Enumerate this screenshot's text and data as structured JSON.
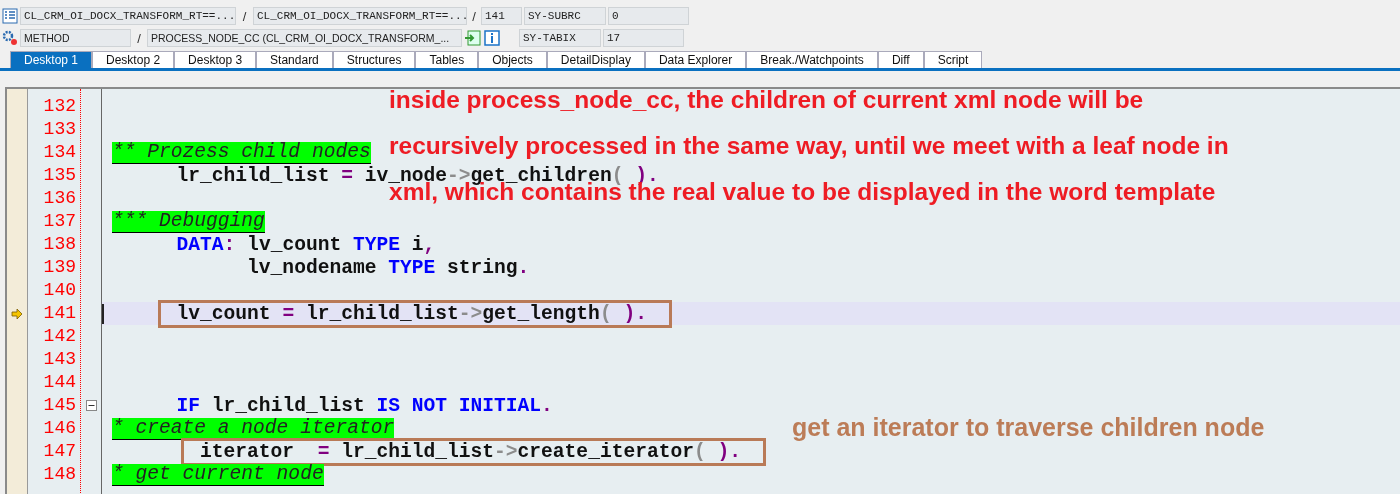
{
  "header": {
    "context": {
      "program": "CL_CRM_OI_DOCX_TRANSFORM_RT==...",
      "separator_1": "/",
      "include": "CL_CRM_OI_DOCX_TRANSFORM_RT==...",
      "separator_2": "/",
      "line": "141"
    },
    "event": {
      "type": "METHOD",
      "separator": "/",
      "name": "PROCESS_NODE_CC (CL_CRM_OI_DOCX_TRANSFORM_..."
    },
    "system_fields": [
      {
        "name": "SY-SUBRC",
        "value": "0"
      },
      {
        "name": "SY-TABIX",
        "value": "17"
      }
    ]
  },
  "tabs": [
    {
      "label": "Desktop 1",
      "selected": true
    },
    {
      "label": "Desktop 2",
      "selected": false
    },
    {
      "label": "Desktop 3",
      "selected": false
    },
    {
      "label": "Standard",
      "selected": false
    },
    {
      "label": "Structures",
      "selected": false
    },
    {
      "label": "Tables",
      "selected": false
    },
    {
      "label": "Objects",
      "selected": false
    },
    {
      "label": "DetailDisplay",
      "selected": false
    },
    {
      "label": "Data Explorer",
      "selected": false
    },
    {
      "label": "Break./Watchpoints",
      "selected": false
    },
    {
      "label": "Diff",
      "selected": false
    },
    {
      "label": "Script",
      "selected": false
    }
  ],
  "editor": {
    "lines": [
      {
        "number": "132",
        "kind": "blank",
        "current": false,
        "boxed": false,
        "fold": false
      },
      {
        "number": "133",
        "kind": "blank",
        "current": false,
        "boxed": false,
        "fold": false
      },
      {
        "number": "134",
        "kind": "comment",
        "text": "** Prozess child nodes",
        "current": false,
        "boxed": false,
        "fold": false
      },
      {
        "number": "135",
        "kind": "code",
        "tokens": [
          {
            "kind": "plain",
            "text": "lr_child_list "
          },
          {
            "kind": "op",
            "text": "="
          },
          {
            "kind": "plain",
            "text": " iv_node"
          },
          {
            "kind": "punct",
            "text": "->"
          },
          {
            "kind": "plain",
            "text": "get_children"
          },
          {
            "kind": "punct",
            "text": "( "
          },
          {
            "kind": "op",
            "text": ")."
          }
        ],
        "current": false,
        "boxed": false,
        "fold": false
      },
      {
        "number": "136",
        "kind": "blank",
        "current": false,
        "boxed": false,
        "fold": false
      },
      {
        "number": "137",
        "kind": "comment",
        "text": "*** Debugging",
        "current": false,
        "boxed": false,
        "fold": false
      },
      {
        "number": "138",
        "kind": "code",
        "tokens": [
          {
            "kind": "keyword",
            "text": "DATA"
          },
          {
            "kind": "op",
            "text": ":"
          },
          {
            "kind": "plain",
            "text": " lv_count "
          },
          {
            "kind": "keyword",
            "text": "TYPE"
          },
          {
            "kind": "plain",
            "text": " i"
          },
          {
            "kind": "op",
            "text": ","
          }
        ],
        "current": false,
        "boxed": false,
        "fold": false
      },
      {
        "number": "139",
        "kind": "code",
        "tokens": [
          {
            "kind": "plain",
            "text": "lv_nodename "
          },
          {
            "kind": "keyword",
            "text": "TYPE"
          },
          {
            "kind": "plain",
            "text": " string"
          },
          {
            "kind": "op",
            "text": "."
          }
        ],
        "current": false,
        "boxed": false,
        "fold": false
      },
      {
        "number": "140",
        "kind": "blank",
        "current": false,
        "boxed": false,
        "fold": false
      },
      {
        "number": "141",
        "kind": "code",
        "tokens": [
          {
            "kind": "plain",
            "text": "lv_count "
          },
          {
            "kind": "op",
            "text": "="
          },
          {
            "kind": "plain",
            "text": " lr_child_list"
          },
          {
            "kind": "punct",
            "text": "->"
          },
          {
            "kind": "plain",
            "text": "get_length"
          },
          {
            "kind": "punct",
            "text": "( "
          },
          {
            "kind": "op",
            "text": ")."
          }
        ],
        "current": true,
        "boxed": true,
        "fold": false
      },
      {
        "number": "142",
        "kind": "blank",
        "current": false,
        "boxed": false,
        "fold": false
      },
      {
        "number": "143",
        "kind": "blank",
        "current": false,
        "boxed": false,
        "fold": false
      },
      {
        "number": "144",
        "kind": "blank",
        "current": false,
        "boxed": false,
        "fold": false
      },
      {
        "number": "145",
        "kind": "code",
        "tokens": [
          {
            "kind": "keyword",
            "text": "IF"
          },
          {
            "kind": "plain",
            "text": " lr_child_list "
          },
          {
            "kind": "keyword",
            "text": "IS NOT INITIAL"
          },
          {
            "kind": "op",
            "text": "."
          }
        ],
        "current": false,
        "boxed": false,
        "fold": true
      },
      {
        "number": "146",
        "kind": "comment",
        "text": "* create a node iterator",
        "current": false,
        "boxed": false,
        "fold": false
      },
      {
        "number": "147",
        "kind": "code",
        "tokens": [
          {
            "kind": "plain",
            "text": "iterator  "
          },
          {
            "kind": "op",
            "text": "="
          },
          {
            "kind": "plain",
            "text": " lr_child_list"
          },
          {
            "kind": "punct",
            "text": "->"
          },
          {
            "kind": "plain",
            "text": "create_iterator"
          },
          {
            "kind": "punct",
            "text": "( "
          },
          {
            "kind": "op",
            "text": ")."
          }
        ],
        "current": false,
        "boxed": true,
        "fold": false
      },
      {
        "number": "148",
        "kind": "comment",
        "text": "* get current node",
        "current": false,
        "boxed": false,
        "fold": false
      }
    ],
    "notes": [
      {
        "kind": "red",
        "lines": [
          "inside process_node_cc, the children of current xml node will be",
          "recursively processed in the same way, until we meet with a leaf node in",
          "xml, which contains the real value to be displayed in the word template"
        ]
      },
      {
        "kind": "brown",
        "lines": [
          "get an iterator to traverse children node"
        ]
      }
    ]
  }
}
